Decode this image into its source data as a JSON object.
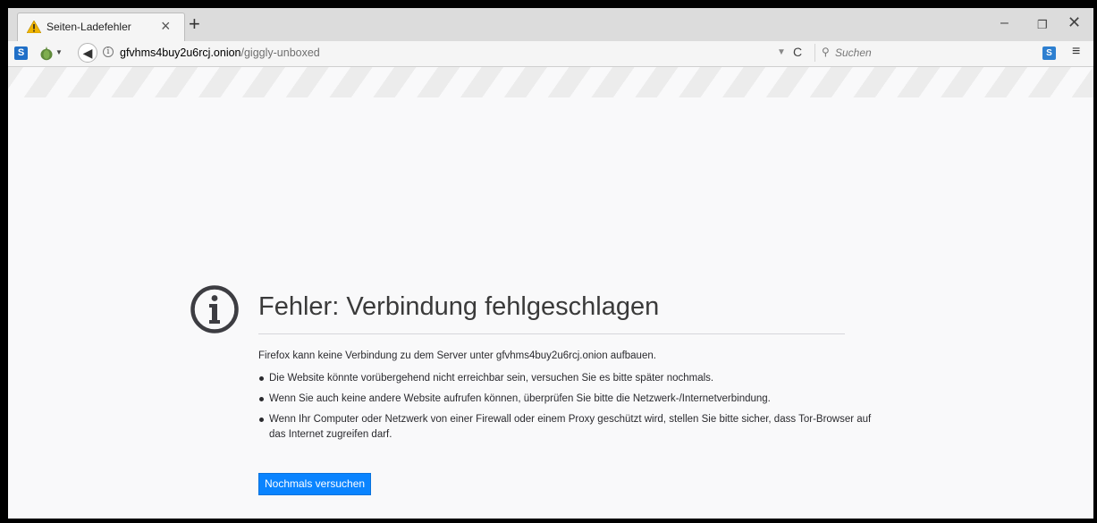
{
  "tab": {
    "title": "Seiten-Ladefehler",
    "close_glyph": "×",
    "icon": "warning-icon"
  },
  "new_tab": {
    "glyph": "+"
  },
  "window": {
    "minimize": "–",
    "restore": "❐",
    "close": "✕"
  },
  "navbar": {
    "s_ext_label": "S",
    "back_glyph": "◀",
    "info_glyph": "i",
    "url_host": "gfvhms4buy2u6rcj.onion",
    "url_path": "/giggly-unboxed",
    "dropdown_glyph": "▼",
    "reload_glyph": "C",
    "search_icon_glyph": "⚲",
    "search_placeholder": "Suchen",
    "ext2_label": "S",
    "menu_glyph": "≡"
  },
  "error_page": {
    "title": "Fehler: Verbindung fehlgeschlagen",
    "description": "Firefox kann keine Verbindung zu dem Server unter gfvhms4buy2u6rcj.onion aufbauen.",
    "bullets": [
      "Die Website könnte vorübergehend nicht erreichbar sein, versuchen Sie es bitte später nochmals.",
      "Wenn Sie auch keine andere Website aufrufen können, überprüfen Sie bitte die Netzwerk-/Internetverbindung.",
      "Wenn Ihr Computer oder Netzwerk von einer Firewall oder einem Proxy geschützt wird, stellen Sie bitte sicher, dass Tor-Browser auf das Internet zugreifen darf."
    ],
    "retry_label": "Nochmals versuchen"
  },
  "colors": {
    "accent": "#0a84ff",
    "warning": "#f0b400"
  }
}
